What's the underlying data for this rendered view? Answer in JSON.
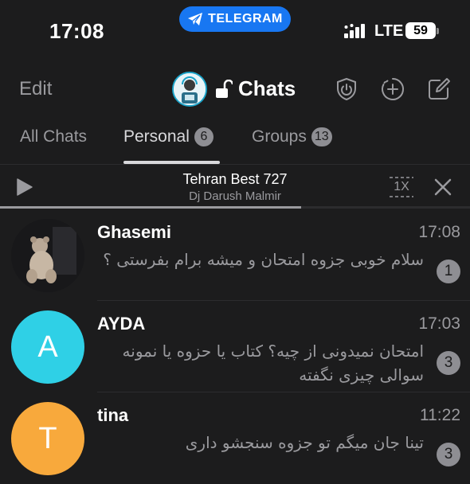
{
  "status_bar": {
    "time": "17:08",
    "app_pill": "TELEGRAM",
    "network": "LTE",
    "battery": "59"
  },
  "header": {
    "edit_label": "Edit",
    "title": "Chats"
  },
  "tabs": [
    {
      "label": "All Chats",
      "badge": ""
    },
    {
      "label": "Personal",
      "badge": "6"
    },
    {
      "label": "Groups",
      "badge": "13"
    }
  ],
  "player": {
    "title": "Tehran Best 727",
    "artist": "Dj Darush Malmir",
    "speed": "1X",
    "progress": 0.64
  },
  "chats": [
    {
      "name": "Ghasemi",
      "time": "17:08",
      "message": "سلام خوبی جزوه امتحان و میشه برام بفرستی ؟",
      "unread": "1",
      "initial": "",
      "color": ""
    },
    {
      "name": "AYDA",
      "time": "17:03",
      "message": "امتحان نمیدونی از چیه؟ کتاب یا حزوه یا نمونه سوالی چیزی نگفته",
      "unread": "3",
      "initial": "A",
      "color": "#2fd0e6"
    },
    {
      "name": "tina",
      "time": "11:22",
      "message": "تینا جان میگم تو جزوه سنجشو داری",
      "unread": "3",
      "initial": "T",
      "color": "#f8a93c"
    }
  ],
  "colors": {
    "background": "#1c1c1d",
    "accent": "#1877f2",
    "secondary_text": "#9a9a9e"
  }
}
